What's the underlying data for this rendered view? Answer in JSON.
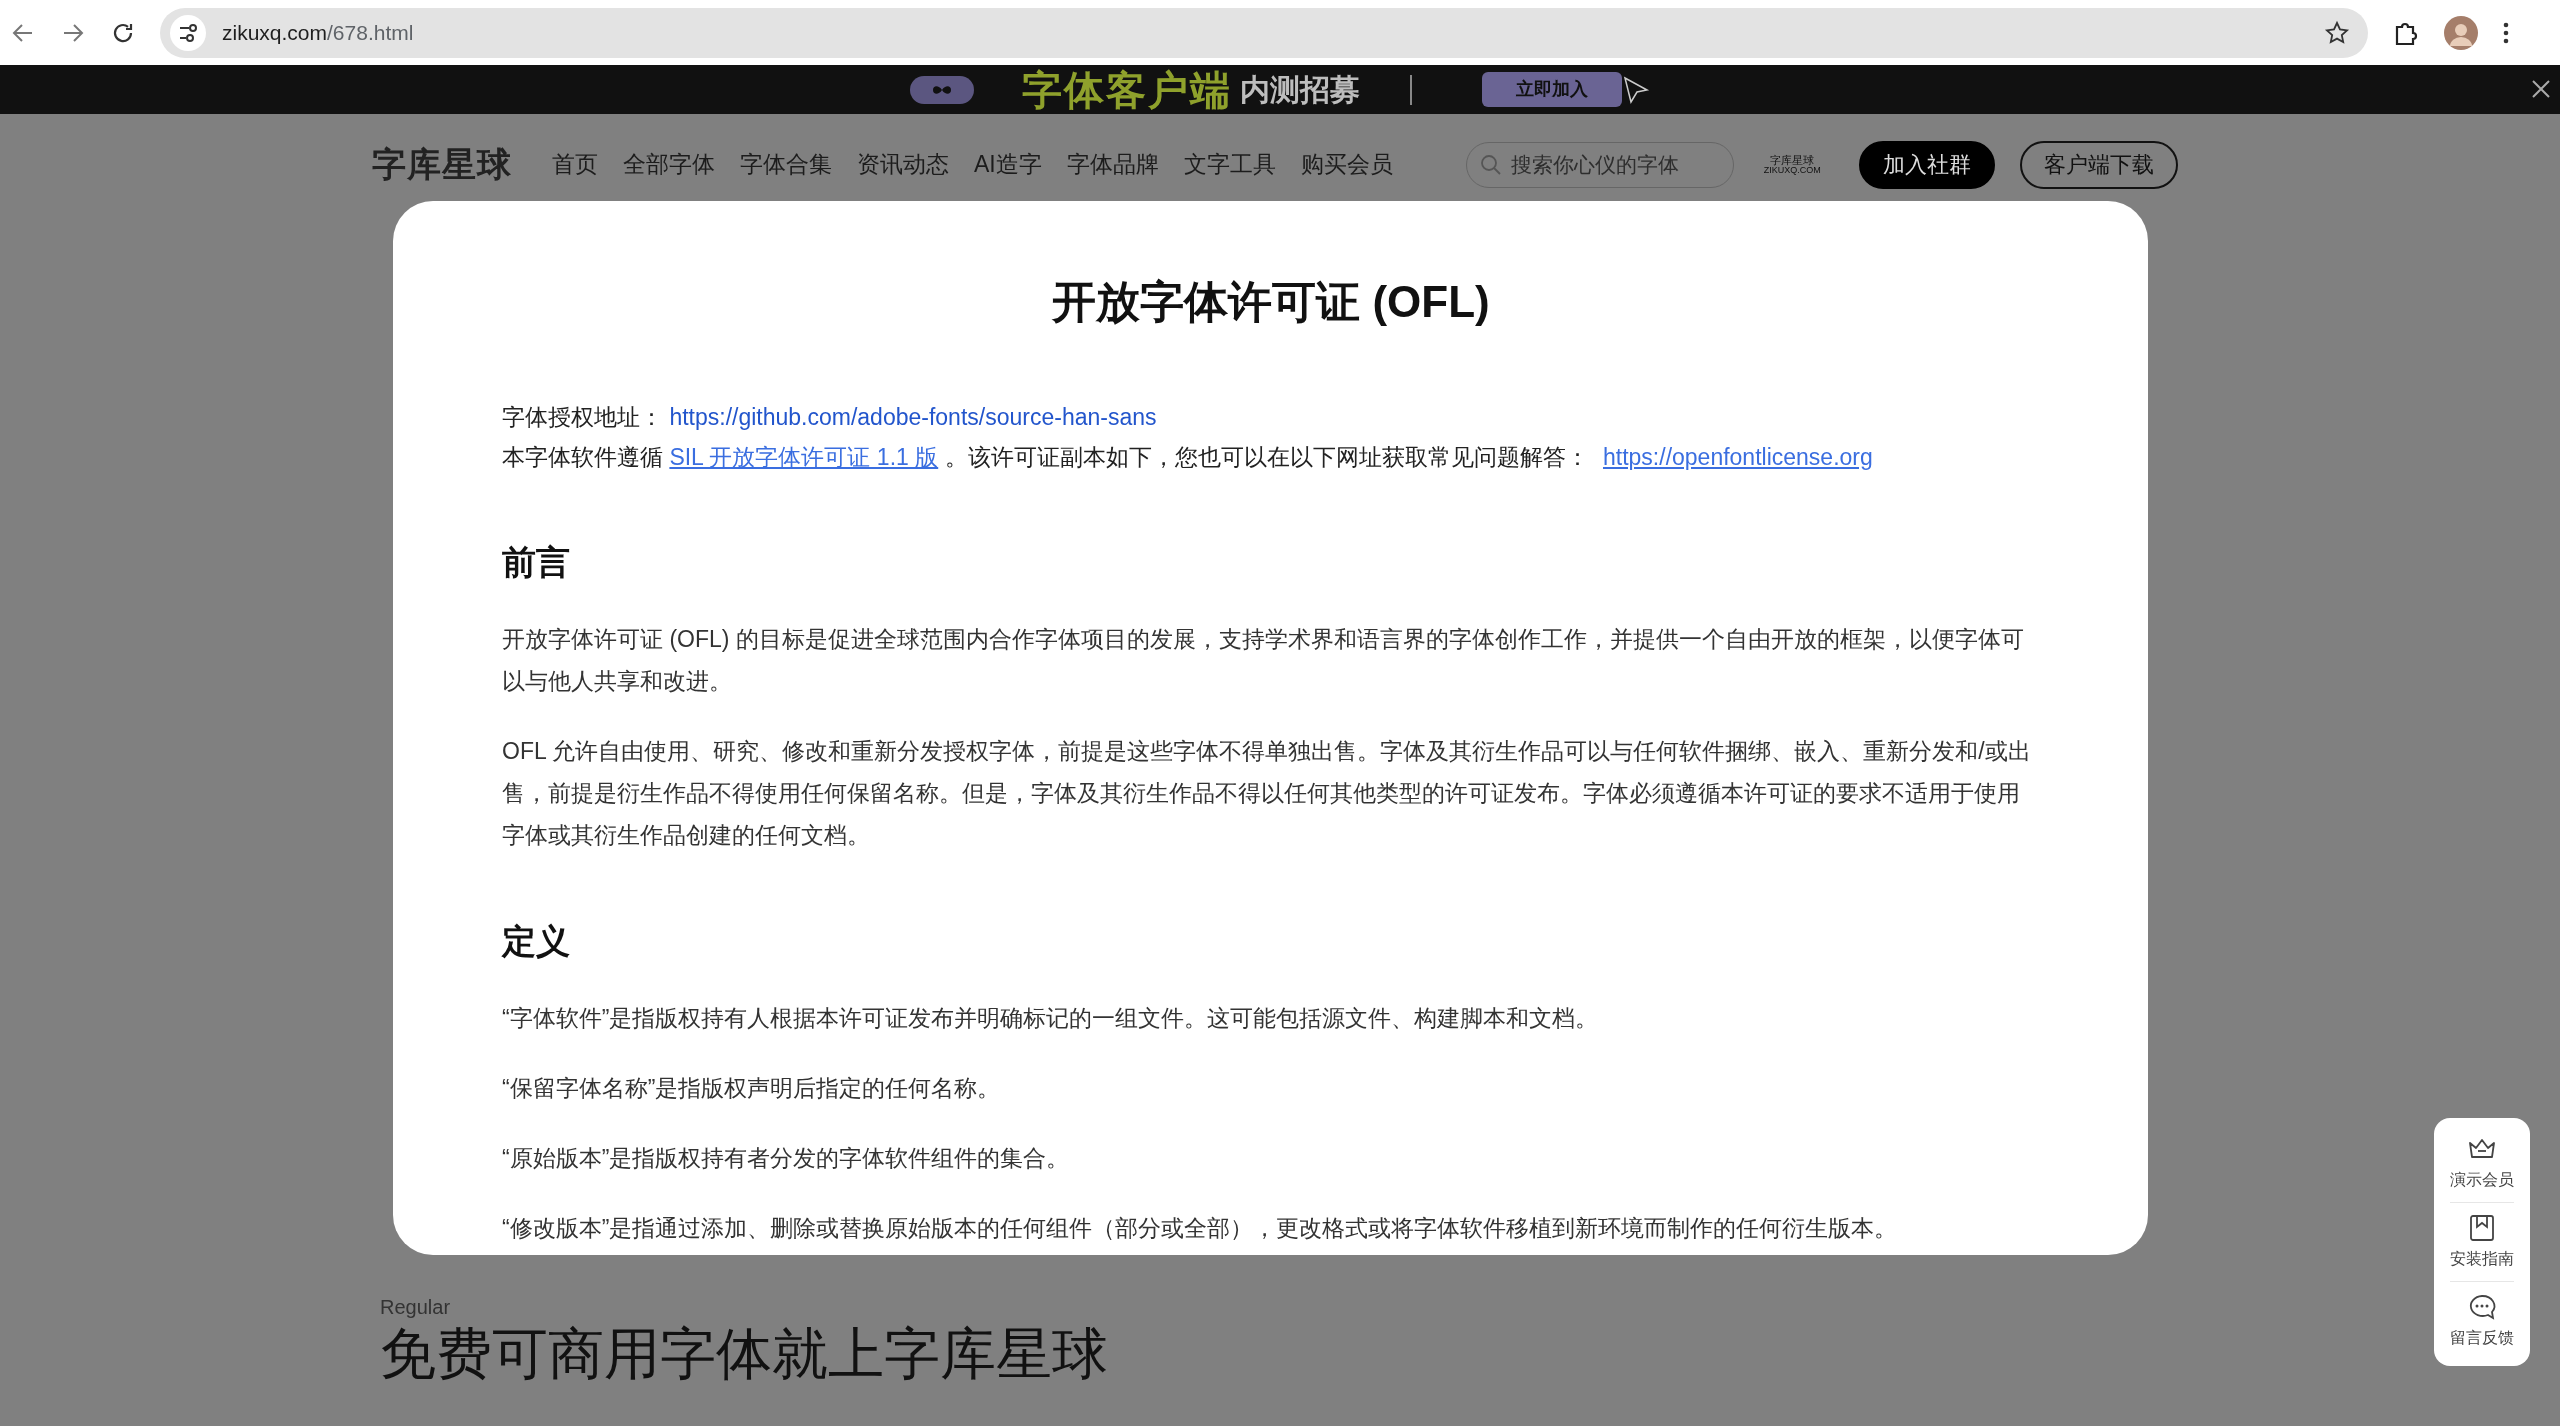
{
  "browser": {
    "url_host": "zikuxq.com",
    "url_path": "/678.html"
  },
  "banner": {
    "title": "字体客户端",
    "subtitle": "内测招募",
    "button": "立即加入"
  },
  "nav": {
    "logo": "字库星球",
    "items": [
      "首页",
      "全部字体",
      "字体合集",
      "资讯动态",
      "AI造字",
      "字体品牌",
      "文字工具",
      "购买会员"
    ],
    "search": {
      "placeholder": "搜索你心仪的字体"
    },
    "mini_logo": {
      "name": "字库星球",
      "domain": "ZIKUXQ.COM"
    },
    "buttons": [
      {
        "label": "加入社群",
        "kind": "solid"
      },
      {
        "label": "客户端下载",
        "kind": "outline"
      }
    ]
  },
  "modal": {
    "title": "开放字体许可证 (OFL)",
    "license": {
      "label": "字体授权地址：",
      "url": "https://github.com/adobe-fonts/source-han-sans"
    },
    "intro": {
      "before": "本字体软件遵循",
      "link": "SIL 开放字体许可证 1.1 版",
      "after": "。该许可证副本如下，您也可以在以下网址获取常见问题解答：",
      "url": "https://openfontlicense.org"
    },
    "sections": [
      {
        "heading": "前言",
        "paragraphs": [
          "开放字体许可证 (OFL) 的目标是促进全球范围内合作字体项目的发展，支持学术界和语言界的字体创作工作，并提供一个自由开放的框架，以便字体可以与他人共享和改进。",
          "OFL 允许自由使用、研究、修改和重新分发授权字体，前提是这些字体不得单独出售。字体及其衍生作品可以与任何软件捆绑、嵌入、重新分发和/或出售，前提是衍生作品不得使用任何保留名称。但是，字体及其衍生作品不得以任何其他类型的许可证发布。字体必须遵循本许可证的要求不适用于使用字体或其衍生作品创建的任何文档。"
        ]
      },
      {
        "heading": "定义",
        "paragraphs": [
          "“字体软件”是指版权持有人根据本许可证发布并明确标记的一组文件。这可能包括源文件、构建脚本和文档。",
          "“保留字体名称”是指版权声明后指定的任何名称。",
          "“原始版本”是指版权持有者分发的字体软件组件的集合。",
          "“修改版本”是指通过添加、删除或替换原始版本的任何组件（部分或全部），更改格式或将字体软件移植到新环境而制作的任何衍生版本。"
        ]
      }
    ]
  },
  "background": {
    "label": "Regular",
    "heading": "免费可商用字体就上字库星球"
  },
  "float_menu": [
    {
      "label": "演示会员",
      "kind": "crown"
    },
    {
      "label": "安装指南",
      "kind": "bookmark"
    },
    {
      "label": "留言反馈",
      "kind": "chat"
    }
  ]
}
